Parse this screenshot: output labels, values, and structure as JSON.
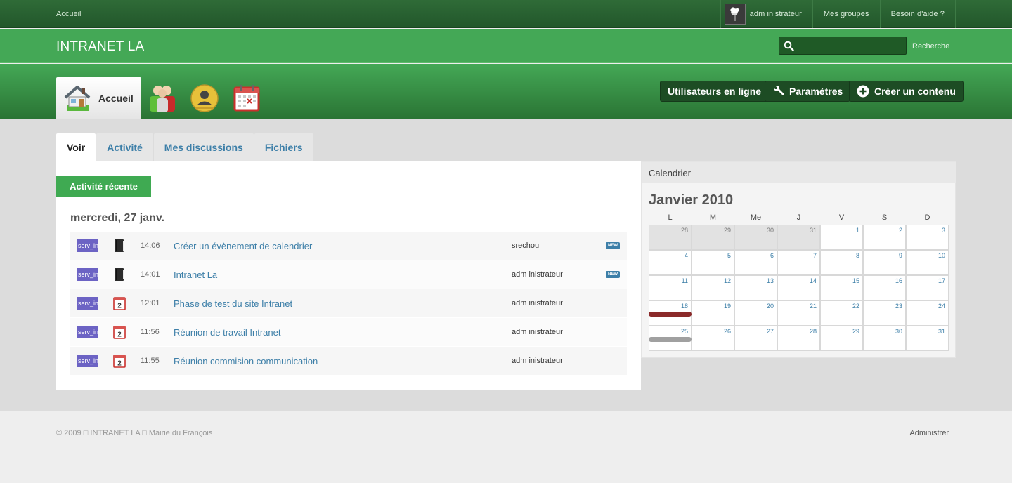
{
  "topbar": {
    "home": "Accueil",
    "user": "adm inistrateur",
    "groups": "Mes groupes",
    "help": "Besoin d'aide ?"
  },
  "header": {
    "site_name": "INTRANET LA",
    "search_placeholder": "",
    "search_label": "Recherche"
  },
  "appbar": {
    "home_label": "Accueil",
    "buttons": {
      "online": "Utilisateurs en ligne",
      "settings": "Paramètres",
      "create": "Créer un contenu"
    }
  },
  "tabs": [
    "Voir",
    "Activité",
    "Mes discussions",
    "Fichiers"
  ],
  "activity": {
    "label": "Activité récente",
    "date": "mercredi, 27 janv.",
    "rows": [
      {
        "group": "serv_in",
        "icon": "book-icon",
        "time": "14:06",
        "title": "Créer un évènement de calendrier",
        "user": "srechou",
        "badge": "NEW"
      },
      {
        "group": "serv_in",
        "icon": "book-icon",
        "time": "14:01",
        "title": "Intranet La",
        "user": "adm inistrateur",
        "badge": "NEW"
      },
      {
        "group": "serv_in",
        "icon": "calendar-icon",
        "time": "12:01",
        "title": "Phase de test du site Intranet",
        "user": "adm inistrateur",
        "badge": ""
      },
      {
        "group": "serv_in",
        "icon": "calendar-icon",
        "time": "11:56",
        "title": "Réunion de travail Intranet",
        "user": "adm inistrateur",
        "badge": ""
      },
      {
        "group": "serv_in",
        "icon": "calendar-icon",
        "time": "11:55",
        "title": "Réunion commision communication",
        "user": "adm inistrateur",
        "badge": ""
      }
    ]
  },
  "calendar": {
    "heading": "Calendrier",
    "month": "Janvier 2010",
    "weekdays": [
      "L",
      "M",
      "Me",
      "J",
      "V",
      "S",
      "D"
    ],
    "weeks": [
      [
        "28",
        "29",
        "30",
        "31",
        "1",
        "2",
        "3"
      ],
      [
        "4",
        "5",
        "6",
        "7",
        "8",
        "9",
        "10"
      ],
      [
        "11",
        "12",
        "13",
        "14",
        "15",
        "16",
        "17"
      ],
      [
        "18",
        "19",
        "20",
        "21",
        "22",
        "23",
        "24"
      ],
      [
        "25",
        "26",
        "27",
        "28",
        "29",
        "30",
        "31"
      ]
    ],
    "other_month_cells": 4,
    "event_colors": {
      "week4": "#8b2a2a",
      "week5": "#a0a0a0"
    }
  },
  "footer": {
    "copyright": "© 2009 □ INTRANET LA □ Mairie du François",
    "admin": "Administrer"
  },
  "colors": {
    "accent": "#44a856",
    "dark": "#22572b",
    "link": "#3d7fa8",
    "group_badge": "#6c63c4"
  }
}
